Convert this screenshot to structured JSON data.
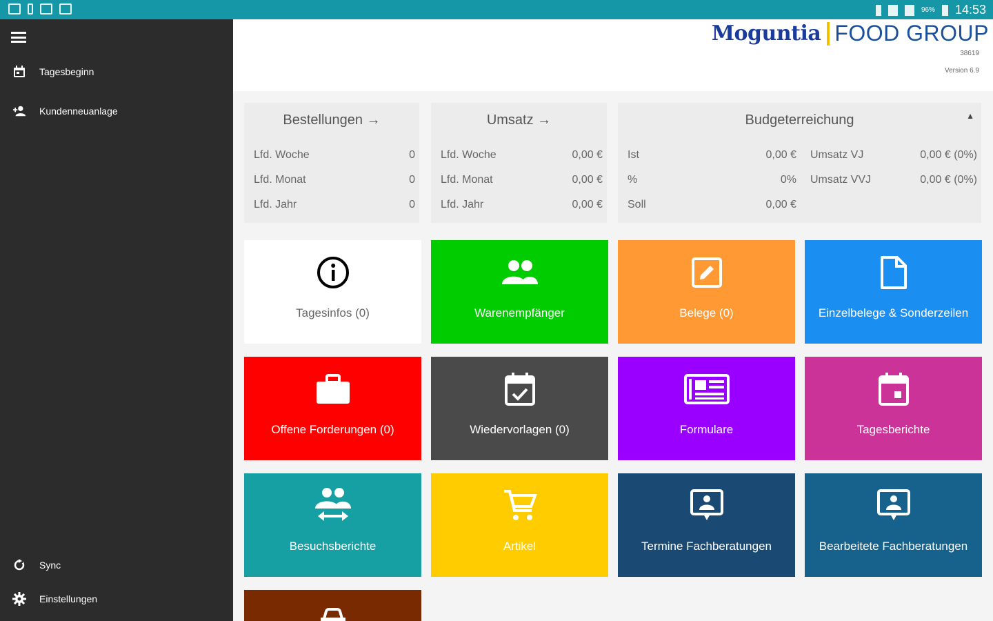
{
  "statusbar": {
    "time": "14:53",
    "battery": "96%"
  },
  "sidebar": {
    "menu_icon": "menu-icon",
    "items": [
      {
        "label": "Tagesbeginn",
        "icon": "calendar-icon"
      },
      {
        "label": "Kundenneuanlage",
        "icon": "add-person-icon"
      },
      {
        "label": "Sync",
        "icon": "sync-icon"
      },
      {
        "label": "Einstellungen",
        "icon": "gear-icon"
      }
    ]
  },
  "header": {
    "brand": "Moguntia",
    "brand_suffix": "FOOD GROUP",
    "user_id": "38619",
    "version": "Version 6.9"
  },
  "stats": {
    "orders": {
      "title": "Bestellungen →",
      "rows": [
        {
          "label": "Lfd. Woche",
          "value": "0"
        },
        {
          "label": "Lfd. Monat",
          "value": "0"
        },
        {
          "label": "Lfd. Jahr",
          "value": "0"
        }
      ]
    },
    "revenue": {
      "title": "Umsatz →",
      "rows": [
        {
          "label": "Lfd. Woche",
          "value": "0,00 €"
        },
        {
          "label": "Lfd. Monat",
          "value": "0,00 €"
        },
        {
          "label": "Lfd. Jahr",
          "value": "0,00 €"
        }
      ]
    },
    "budget": {
      "title": "Budgeterreichung",
      "caret": "▲",
      "rows": [
        {
          "label": "Ist",
          "value": "0,00 €",
          "label2": "Umsatz VJ",
          "value2": "0,00 € (0%)"
        },
        {
          "label": "%",
          "value": "0%",
          "label2": "Umsatz VVJ",
          "value2": "0,00 € (0%)"
        },
        {
          "label": "Soll",
          "value": "0,00 €"
        }
      ]
    }
  },
  "tiles": [
    {
      "label": "Tagesinfos (0)",
      "icon": "info-icon",
      "color": "#ffffff",
      "text_color": "#666666"
    },
    {
      "label": "Warenempfänger",
      "icon": "people-icon",
      "color": "#00cc00",
      "text_color": "#ffffff"
    },
    {
      "label": "Belege (0)",
      "icon": "edit-icon",
      "color": "#ff9933",
      "text_color": "#ffffff"
    },
    {
      "label": "Einzelbelege & Sonderzeilen",
      "icon": "document-icon",
      "color": "#1b8ef2",
      "text_color": "#ffffff"
    },
    {
      "label": "Offene Forderungen (0)",
      "icon": "briefcase-icon",
      "color": "#ff0000",
      "text_color": "#ffffff"
    },
    {
      "label": "Wiedervorlagen (0)",
      "icon": "calendar-check-icon",
      "color": "#4a4a4a",
      "text_color": "#ffffff"
    },
    {
      "label": "Formulare",
      "icon": "newspaper-icon",
      "color": "#9900ff",
      "text_color": "#ffffff"
    },
    {
      "label": "Tagesberichte",
      "icon": "calendar-day-icon",
      "color": "#cc3399",
      "text_color": "#ffffff"
    },
    {
      "label": "Besuchsberichte",
      "icon": "people-swap-icon",
      "color": "#17a0a3",
      "text_color": "#ffffff"
    },
    {
      "label": "Artikel",
      "icon": "cart-icon",
      "color": "#ffcc00",
      "text_color": "#ffffff"
    },
    {
      "label": "Termine Fachberatungen",
      "icon": "presentation-icon",
      "color": "#1a4a73",
      "text_color": "#ffffff"
    },
    {
      "label": "Bearbeitete Fachberatungen",
      "icon": "presentation-icon",
      "color": "#16628c",
      "text_color": "#ffffff"
    },
    {
      "label": "",
      "icon": "car-icon",
      "color": "#7a2a00",
      "text_color": "#ffffff"
    }
  ]
}
